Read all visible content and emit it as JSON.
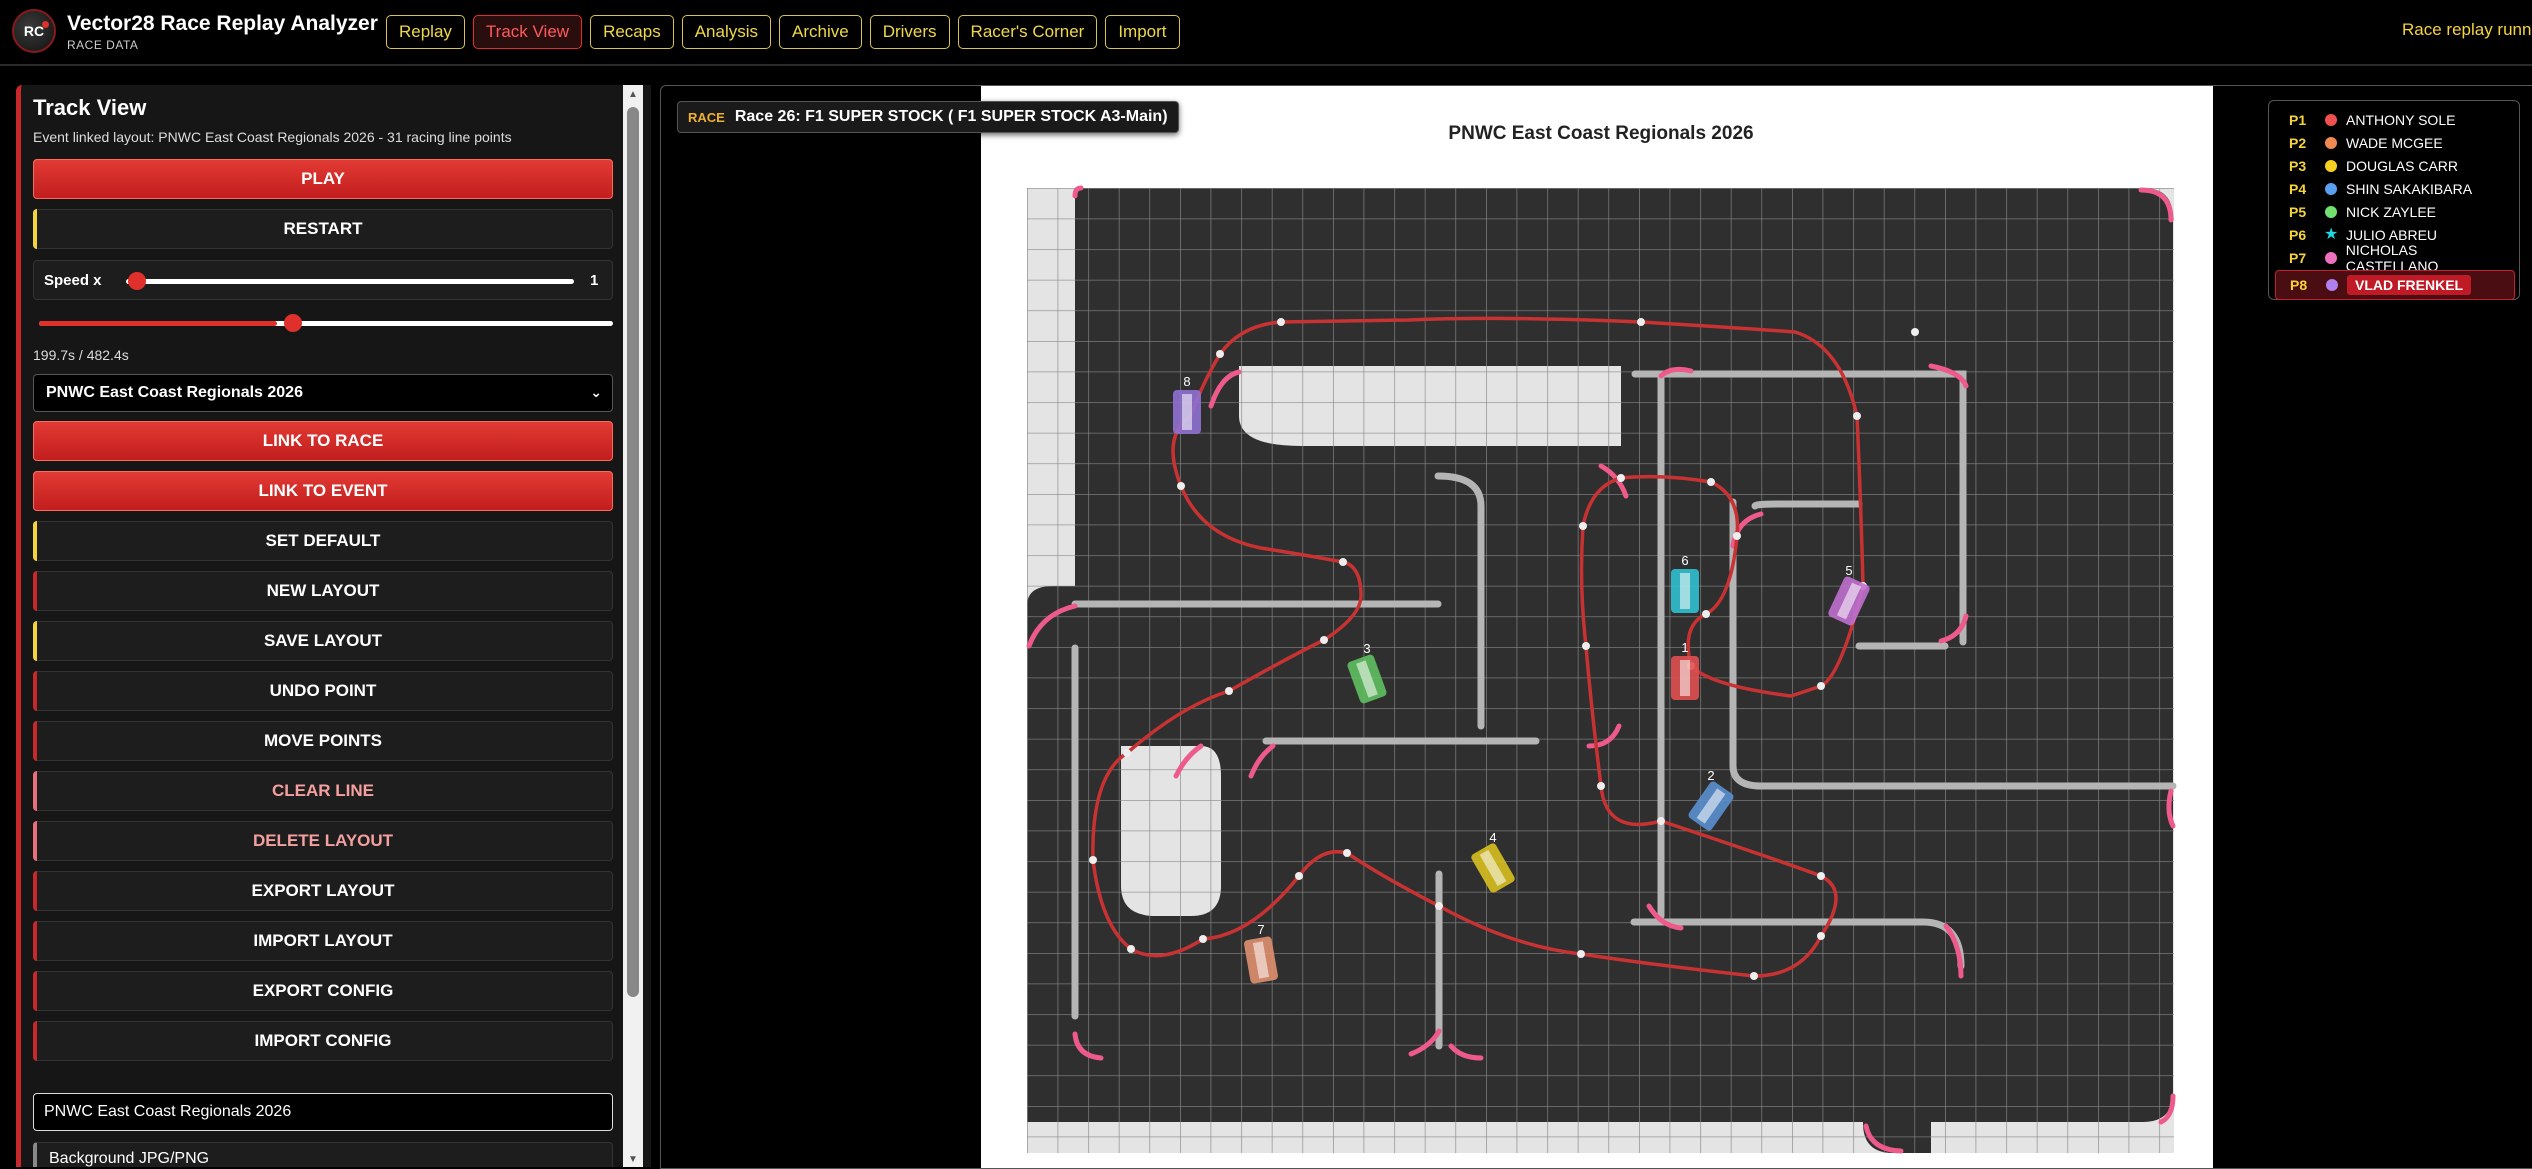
{
  "app": {
    "title": "Vector28 Race Replay Analyzer",
    "subtitle": "RACE DATA",
    "logo_text": "RC"
  },
  "nav": [
    "Replay",
    "Track View",
    "Recaps",
    "Analysis",
    "Archive",
    "Drivers",
    "Racer's Corner",
    "Import"
  ],
  "nav_active": "Track View",
  "status": "Race replay running",
  "panel": {
    "title": "Track View",
    "subtitle": "Event linked layout: PNWC East Coast Regionals 2026 - 31 racing line points",
    "play_label": "PLAY",
    "restart_label": "RESTART",
    "speed_label": "Speed x",
    "speed_value": "1",
    "speed_fraction": 0.0,
    "time_text": "199.7s / 482.4s",
    "time_fraction": 0.414,
    "event_select": "PNWC East Coast Regionals 2026",
    "link_race_label": "LINK TO RACE",
    "link_event_label": "LINK TO EVENT",
    "set_default_label": "SET DEFAULT",
    "new_layout_label": "NEW LAYOUT",
    "save_layout_label": "SAVE LAYOUT",
    "undo_point_label": "UNDO POINT",
    "move_points_label": "MOVE POINTS",
    "clear_line_label": "CLEAR LINE",
    "delete_layout_label": "DELETE LAYOUT",
    "export_layout_label": "EXPORT LAYOUT",
    "import_layout_label": "IMPORT LAYOUT",
    "export_config_label": "EXPORT CONFIG",
    "import_config_label": "IMPORT CONFIG",
    "event_input_value": "PNWC East Coast Regionals 2026",
    "background_label": "Background JPG/PNG",
    "colors": {
      "accent_red": "#c8282a",
      "accent_yellow": "#f5d33b",
      "accent_pink": "#e8707a"
    }
  },
  "map": {
    "race_tag": "RACE",
    "race_name": "Race 26: F1 SUPER STOCK ( F1 SUPER STOCK A3-Main)",
    "track_title": "PNWC East Coast Regionals 2026"
  },
  "legend": [
    {
      "pos": "P1",
      "name": "ANTHONY SOLE",
      "color": "#f05050",
      "marker": "dot"
    },
    {
      "pos": "P2",
      "name": "WADE MCGEE",
      "color": "#f08850",
      "marker": "dot"
    },
    {
      "pos": "P3",
      "name": "DOUGLAS CARR",
      "color": "#f5d020",
      "marker": "dot"
    },
    {
      "pos": "P4",
      "name": "SHIN SAKAKIBARA",
      "color": "#5aa0f0",
      "marker": "dot"
    },
    {
      "pos": "P5",
      "name": "NICK ZAYLEE",
      "color": "#70e070",
      "marker": "dot"
    },
    {
      "pos": "P6",
      "name": "JULIO ABREU",
      "color": "#20d8e0",
      "marker": "star"
    },
    {
      "pos": "P7",
      "name": "NICHOLAS CASTELLANO",
      "color": "#f070c0",
      "marker": "dot"
    },
    {
      "pos": "P8",
      "name": "VLAD FRENKEL",
      "color": "#b080f0",
      "marker": "dot"
    }
  ],
  "cars": [
    {
      "num": "1",
      "color": "#e05050"
    },
    {
      "num": "2",
      "color": "#5a90d0"
    },
    {
      "num": "3",
      "color": "#60c060"
    },
    {
      "num": "4",
      "color": "#d8c020"
    },
    {
      "num": "5",
      "color": "#c070d0"
    },
    {
      "num": "6",
      "color": "#30c0d0"
    },
    {
      "num": "7",
      "color": "#e09070"
    },
    {
      "num": "8",
      "color": "#9070d0"
    }
  ]
}
